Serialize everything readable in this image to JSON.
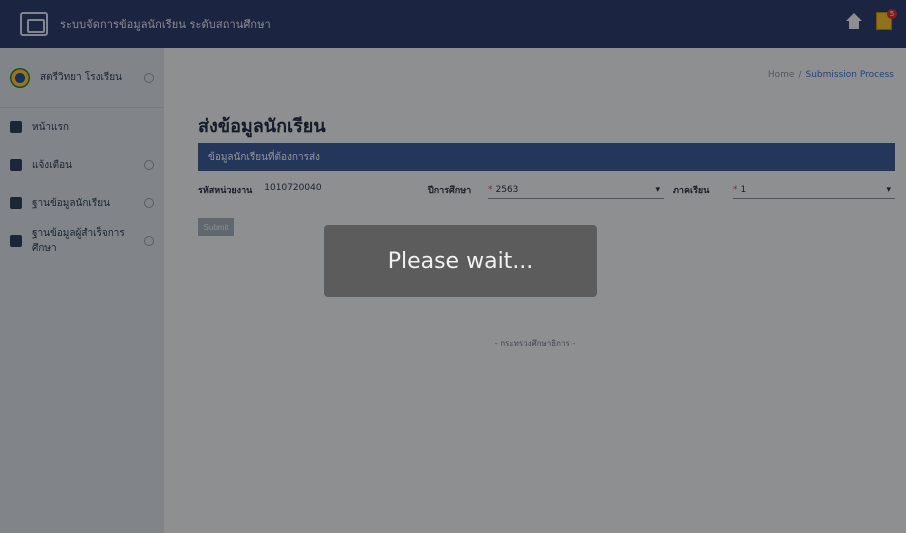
{
  "header": {
    "title": "ระบบจัดการข้อมูลนักเรียน ระดับสถานศึกษา",
    "notification_count": "5"
  },
  "sidebar": {
    "school_name": "สตรีวิทยา โรงเรียน",
    "items": [
      {
        "label": "หน้าแรก"
      },
      {
        "label": "แจ้งเตือน"
      },
      {
        "label": "ฐานข้อมูลนักเรียน"
      },
      {
        "label": "ฐานข้อมูลผู้สำเร็จการศึกษา"
      }
    ]
  },
  "breadcrumb": {
    "home": "Home",
    "separator": "/",
    "current": "Submission Process"
  },
  "page": {
    "title": "ส่งข้อมูลนักเรียน",
    "panel_title": "ข้อมูลนักเรียนที่ต้องการส่ง",
    "school_code_label": "รหัสหน่วยงาน",
    "school_code_value": "1010720040",
    "year_label": "ปีการศึกษา",
    "year_value": "2563",
    "semester_label": "ภาคเรียน",
    "semester_value": "1",
    "submit_label": "Submit",
    "footer": "- กระทรวงศึกษาธิการ -"
  },
  "overlay": {
    "message": "Please wait..."
  }
}
